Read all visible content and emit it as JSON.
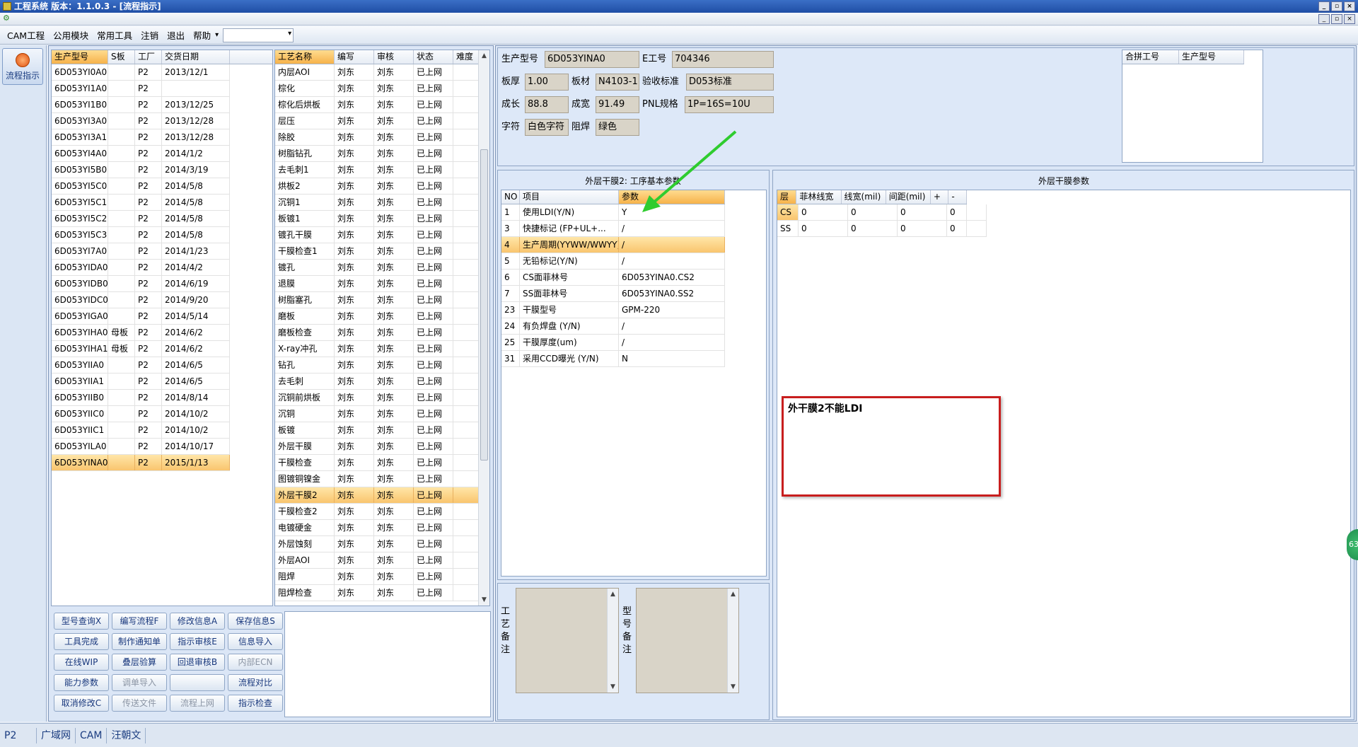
{
  "window": {
    "title": "工程系统   版本：1.1.0.3 - [流程指示]",
    "min": "_",
    "restore": "▫",
    "close": "×"
  },
  "menu": [
    "CAM工程",
    "公用模块",
    "常用工具",
    "注销",
    "退出",
    "帮助"
  ],
  "side_button": {
    "label": "流程指示"
  },
  "models": {
    "headers": [
      "生产型号",
      "S板",
      "工厂",
      "交货日期"
    ],
    "rows": [
      [
        "6D053YI0A0",
        "",
        "P2",
        "2013/12/1"
      ],
      [
        "6D053YI1A0",
        "",
        "P2",
        ""
      ],
      [
        "6D053YI1B0",
        "",
        "P2",
        "2013/12/25"
      ],
      [
        "6D053YI3A0",
        "",
        "P2",
        "2013/12/28"
      ],
      [
        "6D053YI3A1",
        "",
        "P2",
        "2013/12/28"
      ],
      [
        "6D053YI4A0",
        "",
        "P2",
        "2014/1/2"
      ],
      [
        "6D053YI5B0",
        "",
        "P2",
        "2014/3/19"
      ],
      [
        "6D053YI5C0",
        "",
        "P2",
        "2014/5/8"
      ],
      [
        "6D053YI5C1",
        "",
        "P2",
        "2014/5/8"
      ],
      [
        "6D053YI5C2",
        "",
        "P2",
        "2014/5/8"
      ],
      [
        "6D053YI5C3",
        "",
        "P2",
        "2014/5/8"
      ],
      [
        "6D053YI7A0",
        "",
        "P2",
        "2014/1/23"
      ],
      [
        "6D053YIDA0",
        "",
        "P2",
        "2014/4/2"
      ],
      [
        "6D053YIDB0",
        "",
        "P2",
        "2014/6/19"
      ],
      [
        "6D053YIDC0",
        "",
        "P2",
        "2014/9/20"
      ],
      [
        "6D053YIGA0",
        "",
        "P2",
        "2014/5/14"
      ],
      [
        "6D053YIHA0",
        "母板",
        "P2",
        "2014/6/2"
      ],
      [
        "6D053YIHA1",
        "母板",
        "P2",
        "2014/6/2"
      ],
      [
        "6D053YIIA0",
        "",
        "P2",
        "2014/6/5"
      ],
      [
        "6D053YIIA1",
        "",
        "P2",
        "2014/6/5"
      ],
      [
        "6D053YIIB0",
        "",
        "P2",
        "2014/8/14"
      ],
      [
        "6D053YIIC0",
        "",
        "P2",
        "2014/10/2"
      ],
      [
        "6D053YIIC1",
        "",
        "P2",
        "2014/10/2"
      ],
      [
        "6D053YILA0",
        "",
        "P2",
        "2014/10/17"
      ],
      [
        "6D053YINA0",
        "",
        "P2",
        "2015/1/13"
      ]
    ],
    "selected": 24
  },
  "processes": {
    "headers": [
      "工艺名称",
      "编写",
      "审核",
      "状态",
      "难度"
    ],
    "rows": [
      [
        "内层AOI",
        "刘东",
        "刘东",
        "已上网",
        ""
      ],
      [
        "棕化",
        "刘东",
        "刘东",
        "已上网",
        ""
      ],
      [
        "棕化后烘板",
        "刘东",
        "刘东",
        "已上网",
        ""
      ],
      [
        "层压",
        "刘东",
        "刘东",
        "已上网",
        ""
      ],
      [
        "除胶",
        "刘东",
        "刘东",
        "已上网",
        ""
      ],
      [
        "树脂钻孔",
        "刘东",
        "刘东",
        "已上网",
        ""
      ],
      [
        "去毛刺1",
        "刘东",
        "刘东",
        "已上网",
        ""
      ],
      [
        "烘板2",
        "刘东",
        "刘东",
        "已上网",
        ""
      ],
      [
        "沉铜1",
        "刘东",
        "刘东",
        "已上网",
        ""
      ],
      [
        "板镀1",
        "刘东",
        "刘东",
        "已上网",
        ""
      ],
      [
        "镀孔干膜",
        "刘东",
        "刘东",
        "已上网",
        ""
      ],
      [
        "干膜检查1",
        "刘东",
        "刘东",
        "已上网",
        ""
      ],
      [
        "镀孔",
        "刘东",
        "刘东",
        "已上网",
        ""
      ],
      [
        "退膜",
        "刘东",
        "刘东",
        "已上网",
        ""
      ],
      [
        "树脂塞孔",
        "刘东",
        "刘东",
        "已上网",
        ""
      ],
      [
        "磨板",
        "刘东",
        "刘东",
        "已上网",
        ""
      ],
      [
        "磨板检查",
        "刘东",
        "刘东",
        "已上网",
        ""
      ],
      [
        "X-ray冲孔",
        "刘东",
        "刘东",
        "已上网",
        ""
      ],
      [
        "钻孔",
        "刘东",
        "刘东",
        "已上网",
        ""
      ],
      [
        "去毛刺",
        "刘东",
        "刘东",
        "已上网",
        ""
      ],
      [
        "沉铜前烘板",
        "刘东",
        "刘东",
        "已上网",
        ""
      ],
      [
        "沉铜",
        "刘东",
        "刘东",
        "已上网",
        ""
      ],
      [
        "板镀",
        "刘东",
        "刘东",
        "已上网",
        ""
      ],
      [
        "外层干膜",
        "刘东",
        "刘东",
        "已上网",
        ""
      ],
      [
        "干膜检查",
        "刘东",
        "刘东",
        "已上网",
        ""
      ],
      [
        "图镀铜镍金",
        "刘东",
        "刘东",
        "已上网",
        ""
      ],
      [
        "外层干膜2",
        "刘东",
        "刘东",
        "已上网",
        ""
      ],
      [
        "干膜检查2",
        "刘东",
        "刘东",
        "已上网",
        ""
      ],
      [
        "电镀硬金",
        "刘东",
        "刘东",
        "已上网",
        ""
      ],
      [
        "外层蚀刻",
        "刘东",
        "刘东",
        "已上网",
        ""
      ],
      [
        "外层AOI",
        "刘东",
        "刘东",
        "已上网",
        ""
      ],
      [
        "阻焊",
        "刘东",
        "刘东",
        "已上网",
        ""
      ],
      [
        "阻焊检查",
        "刘东",
        "刘东",
        "已上网",
        ""
      ]
    ],
    "selected": 26
  },
  "buttons": [
    {
      "label": "型号查询X",
      "disabled": false
    },
    {
      "label": "编写流程F",
      "disabled": false
    },
    {
      "label": "修改信息A",
      "disabled": false
    },
    {
      "label": "保存信息S",
      "disabled": false
    },
    {
      "label": "工具完成",
      "disabled": false
    },
    {
      "label": "制作通知单",
      "disabled": false
    },
    {
      "label": "指示审核E",
      "disabled": false
    },
    {
      "label": "信息导入",
      "disabled": false
    },
    {
      "label": "在线WIP",
      "disabled": false
    },
    {
      "label": "叠层验算",
      "disabled": false
    },
    {
      "label": "回退审核B",
      "disabled": false
    },
    {
      "label": "内部ECN",
      "disabled": true
    },
    {
      "label": "能力参数",
      "disabled": false
    },
    {
      "label": "调单导入",
      "disabled": true
    },
    {
      "label": "",
      "disabled": true
    },
    {
      "label": "流程对比",
      "disabled": false
    },
    {
      "label": "取消修改C",
      "disabled": false
    },
    {
      "label": "传送文件",
      "disabled": true
    },
    {
      "label": "流程上网",
      "disabled": true
    },
    {
      "label": "指示检查",
      "disabled": false
    }
  ],
  "info": {
    "prod_model_label": "生产型号",
    "prod_model": "6D053YINA0",
    "e_no_label": "E工号",
    "e_no": "704346",
    "thick_label": "板厚",
    "thick": "1.00",
    "material_label": "板材",
    "material": "N4103-1",
    "accept_label": "验收标准",
    "accept": "D053标准",
    "len_label": "成长",
    "len": "88.8",
    "width_label": "成宽",
    "width": "91.49",
    "pnl_label": "PNL规格",
    "pnl": "1P=16S=10U",
    "char_label": "字符",
    "char": "白色字符",
    "mask_label": "阻焊",
    "mask": "绿色"
  },
  "merge": {
    "headers": [
      "合拼工号",
      "生产型号"
    ]
  },
  "params": {
    "title": "外层干膜2: 工序基本参数",
    "headers": [
      "NO",
      "项目",
      "参数"
    ],
    "rows": [
      [
        "1",
        "使用LDI(Y/N)",
        "Y"
      ],
      [
        "3",
        "快捷标记 (FP+UL+...",
        ""
      ],
      [
        "4",
        "生产周期(YYWW/WWYY)",
        "/"
      ],
      [
        "5",
        "无铅标记(Y/N)",
        "/"
      ],
      [
        "6",
        "CS面菲林号",
        "6D053YINA0.CS2"
      ],
      [
        "7",
        "SS面菲林号",
        "6D053YINA0.SS2"
      ],
      [
        "23",
        "干膜型号",
        "GPM-220"
      ],
      [
        "24",
        "有负焊盘 (Y/N)",
        "/"
      ],
      [
        "25",
        "干膜厚度(um)",
        "/"
      ],
      [
        "31",
        "采用CCD曝光 (Y/N)",
        "N"
      ]
    ],
    "quick_mark_value": "/",
    "selected": 2
  },
  "outer": {
    "title": "外层干膜参数",
    "headers": [
      "层",
      "菲林线宽",
      "线宽(mil)",
      "间距(mil)",
      "+",
      "-"
    ],
    "rows": [
      [
        "CS",
        "0",
        "0",
        "0",
        "0",
        ""
      ],
      [
        "SS",
        "0",
        "0",
        "0",
        "0",
        ""
      ]
    ]
  },
  "warning": "外干膜2不能LDI",
  "remarks": {
    "craft": "工艺备注",
    "model": "型号备注"
  },
  "side_badge": "63",
  "status": [
    "P2",
    "广域网",
    "CAM",
    "汪朝文"
  ],
  "colors": {
    "accent": "#f6b24a",
    "arrow": "#2fcc2f",
    "warning_border": "#c81e1e"
  }
}
